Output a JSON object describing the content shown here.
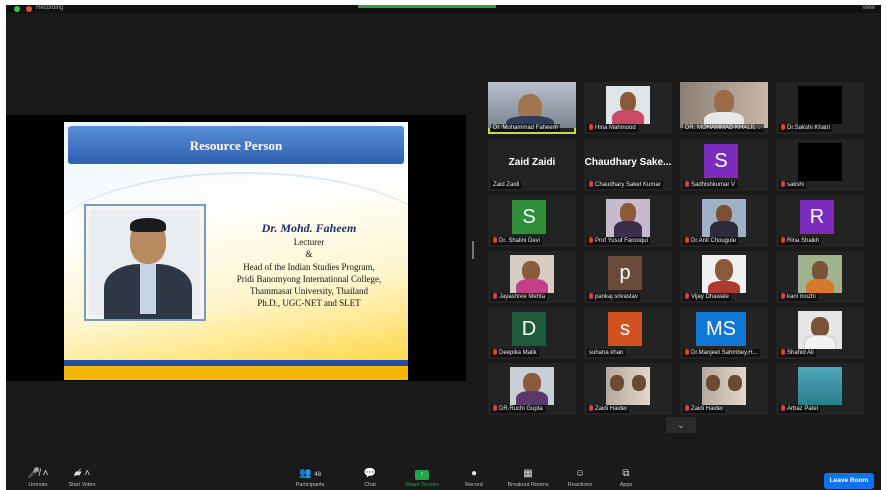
{
  "topbar": {
    "recording": "Recording",
    "view": "View"
  },
  "slide": {
    "title": "Resource Person",
    "name": "Dr. Mohd. Faheem",
    "lines": [
      "Lecturer",
      "&",
      "Head of the Indian Studies Program,",
      "Pridi Banomyong International College,",
      "Thammasat University, Thailand",
      "Ph.D., UGC-NET and SLET"
    ]
  },
  "gallery": [
    {
      "name": "Dr. Mohammad Faheem",
      "muted": false
    },
    {
      "name": "Hina Mahmood",
      "muted": true
    },
    {
      "name": "DR. MOHAMMAD KHALIL ...",
      "muted": false
    },
    {
      "name": "Dr.Sakshi Khatri",
      "muted": true
    },
    {
      "name": "Zaid Zaidi",
      "muted": false,
      "display": "Zaid Zaidi"
    },
    {
      "name": "Chaudhary Saket Kumar",
      "muted": true,
      "display": "Chaudhary Sake..."
    },
    {
      "name": "Sadhishkumar V",
      "muted": true,
      "initials": "S"
    },
    {
      "name": "sakshi",
      "muted": true
    },
    {
      "name": "Dr. Shalini Devi",
      "muted": true,
      "initials": "S"
    },
    {
      "name": "Prof Yusuf Farooqui",
      "muted": true
    },
    {
      "name": "Dr.Anil Chougule",
      "muted": true
    },
    {
      "name": "Rina Shaikh",
      "muted": true,
      "initials": "R"
    },
    {
      "name": "Jayashree Mehta",
      "muted": true
    },
    {
      "name": "pankaj srivastav",
      "muted": true,
      "initials": "p"
    },
    {
      "name": "Vijay Dhawale",
      "muted": true
    },
    {
      "name": "kani mozhi",
      "muted": true
    },
    {
      "name": "Deepika Malik",
      "muted": true,
      "initials": "D"
    },
    {
      "name": "suhana khan",
      "muted": false,
      "initials": "s"
    },
    {
      "name": "Dr.Manjeet Sahmbey.H...",
      "muted": true,
      "initials": "MS"
    },
    {
      "name": "Shahid Ali",
      "muted": true
    },
    {
      "name": "DR.Ruchi Gupta",
      "muted": true
    },
    {
      "name": "Zaidi Haider",
      "muted": true
    },
    {
      "name": "Zaidi Haider",
      "muted": true
    },
    {
      "name": "Arbaz Patel",
      "muted": true
    }
  ],
  "colors": {
    "active_border": "#c7d64a",
    "avatar_purple": "#7b2cbf",
    "avatar_green": "#2f8f3a",
    "avatar_brown": "#6a4a3a",
    "avatar_dark_green": "#1e5a3a",
    "avatar_orange": "#d0531f",
    "avatar_blue": "#0e78d4",
    "leave": "#0e72ed",
    "share": "#23a34a"
  },
  "toolbar": {
    "unmute": "Unmute",
    "start_video": "Start Video",
    "participants": "Participants",
    "participants_count": "48",
    "chat": "Chat",
    "share_screen": "Share Screen",
    "record": "Record",
    "breakout_rooms": "Breakout Rooms",
    "reactions": "Reactions",
    "apps": "Apps",
    "leave": "Leave Room"
  }
}
